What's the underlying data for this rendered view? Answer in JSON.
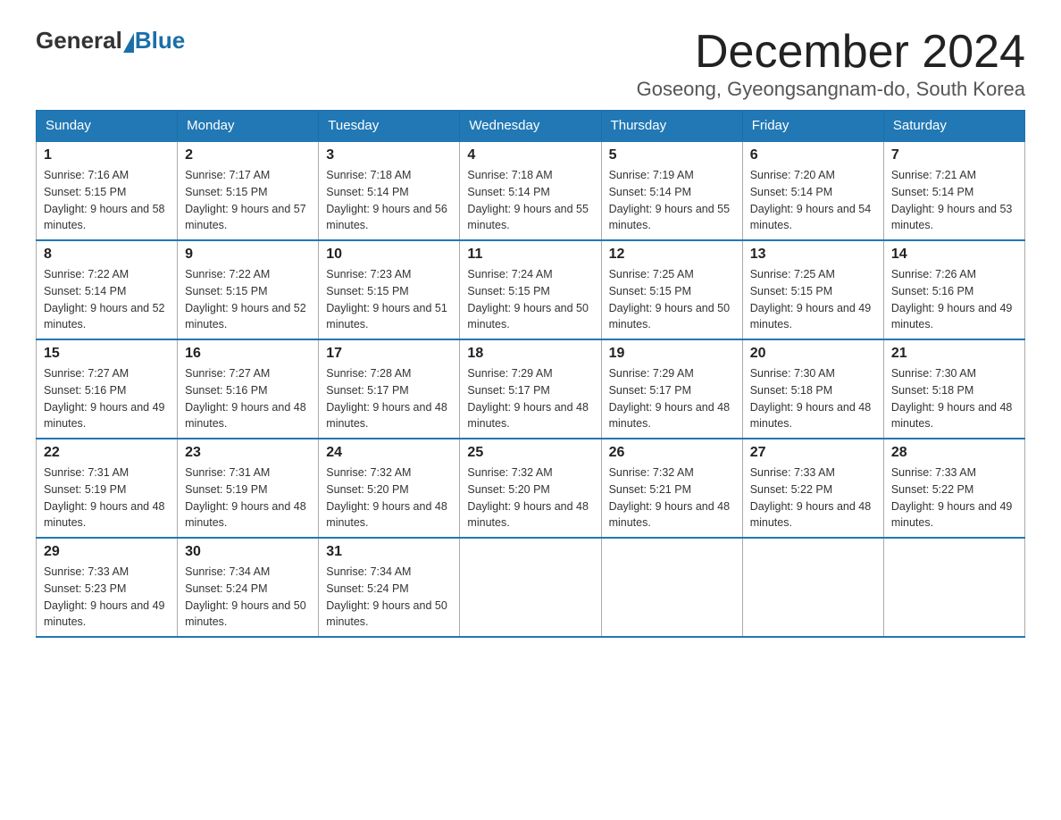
{
  "header": {
    "logo_general": "General",
    "logo_blue": "Blue",
    "month_title": "December 2024",
    "location": "Goseong, Gyeongsangnam-do, South Korea"
  },
  "weekdays": [
    "Sunday",
    "Monday",
    "Tuesday",
    "Wednesday",
    "Thursday",
    "Friday",
    "Saturday"
  ],
  "weeks": [
    [
      {
        "day": "1",
        "sunrise": "7:16 AM",
        "sunset": "5:15 PM",
        "daylight": "9 hours and 58 minutes."
      },
      {
        "day": "2",
        "sunrise": "7:17 AM",
        "sunset": "5:15 PM",
        "daylight": "9 hours and 57 minutes."
      },
      {
        "day": "3",
        "sunrise": "7:18 AM",
        "sunset": "5:14 PM",
        "daylight": "9 hours and 56 minutes."
      },
      {
        "day": "4",
        "sunrise": "7:18 AM",
        "sunset": "5:14 PM",
        "daylight": "9 hours and 55 minutes."
      },
      {
        "day": "5",
        "sunrise": "7:19 AM",
        "sunset": "5:14 PM",
        "daylight": "9 hours and 55 minutes."
      },
      {
        "day": "6",
        "sunrise": "7:20 AM",
        "sunset": "5:14 PM",
        "daylight": "9 hours and 54 minutes."
      },
      {
        "day": "7",
        "sunrise": "7:21 AM",
        "sunset": "5:14 PM",
        "daylight": "9 hours and 53 minutes."
      }
    ],
    [
      {
        "day": "8",
        "sunrise": "7:22 AM",
        "sunset": "5:14 PM",
        "daylight": "9 hours and 52 minutes."
      },
      {
        "day": "9",
        "sunrise": "7:22 AM",
        "sunset": "5:15 PM",
        "daylight": "9 hours and 52 minutes."
      },
      {
        "day": "10",
        "sunrise": "7:23 AM",
        "sunset": "5:15 PM",
        "daylight": "9 hours and 51 minutes."
      },
      {
        "day": "11",
        "sunrise": "7:24 AM",
        "sunset": "5:15 PM",
        "daylight": "9 hours and 50 minutes."
      },
      {
        "day": "12",
        "sunrise": "7:25 AM",
        "sunset": "5:15 PM",
        "daylight": "9 hours and 50 minutes."
      },
      {
        "day": "13",
        "sunrise": "7:25 AM",
        "sunset": "5:15 PM",
        "daylight": "9 hours and 49 minutes."
      },
      {
        "day": "14",
        "sunrise": "7:26 AM",
        "sunset": "5:16 PM",
        "daylight": "9 hours and 49 minutes."
      }
    ],
    [
      {
        "day": "15",
        "sunrise": "7:27 AM",
        "sunset": "5:16 PM",
        "daylight": "9 hours and 49 minutes."
      },
      {
        "day": "16",
        "sunrise": "7:27 AM",
        "sunset": "5:16 PM",
        "daylight": "9 hours and 48 minutes."
      },
      {
        "day": "17",
        "sunrise": "7:28 AM",
        "sunset": "5:17 PM",
        "daylight": "9 hours and 48 minutes."
      },
      {
        "day": "18",
        "sunrise": "7:29 AM",
        "sunset": "5:17 PM",
        "daylight": "9 hours and 48 minutes."
      },
      {
        "day": "19",
        "sunrise": "7:29 AM",
        "sunset": "5:17 PM",
        "daylight": "9 hours and 48 minutes."
      },
      {
        "day": "20",
        "sunrise": "7:30 AM",
        "sunset": "5:18 PM",
        "daylight": "9 hours and 48 minutes."
      },
      {
        "day": "21",
        "sunrise": "7:30 AM",
        "sunset": "5:18 PM",
        "daylight": "9 hours and 48 minutes."
      }
    ],
    [
      {
        "day": "22",
        "sunrise": "7:31 AM",
        "sunset": "5:19 PM",
        "daylight": "9 hours and 48 minutes."
      },
      {
        "day": "23",
        "sunrise": "7:31 AM",
        "sunset": "5:19 PM",
        "daylight": "9 hours and 48 minutes."
      },
      {
        "day": "24",
        "sunrise": "7:32 AM",
        "sunset": "5:20 PM",
        "daylight": "9 hours and 48 minutes."
      },
      {
        "day": "25",
        "sunrise": "7:32 AM",
        "sunset": "5:20 PM",
        "daylight": "9 hours and 48 minutes."
      },
      {
        "day": "26",
        "sunrise": "7:32 AM",
        "sunset": "5:21 PM",
        "daylight": "9 hours and 48 minutes."
      },
      {
        "day": "27",
        "sunrise": "7:33 AM",
        "sunset": "5:22 PM",
        "daylight": "9 hours and 48 minutes."
      },
      {
        "day": "28",
        "sunrise": "7:33 AM",
        "sunset": "5:22 PM",
        "daylight": "9 hours and 49 minutes."
      }
    ],
    [
      {
        "day": "29",
        "sunrise": "7:33 AM",
        "sunset": "5:23 PM",
        "daylight": "9 hours and 49 minutes."
      },
      {
        "day": "30",
        "sunrise": "7:34 AM",
        "sunset": "5:24 PM",
        "daylight": "9 hours and 50 minutes."
      },
      {
        "day": "31",
        "sunrise": "7:34 AM",
        "sunset": "5:24 PM",
        "daylight": "9 hours and 50 minutes."
      },
      null,
      null,
      null,
      null
    ]
  ]
}
